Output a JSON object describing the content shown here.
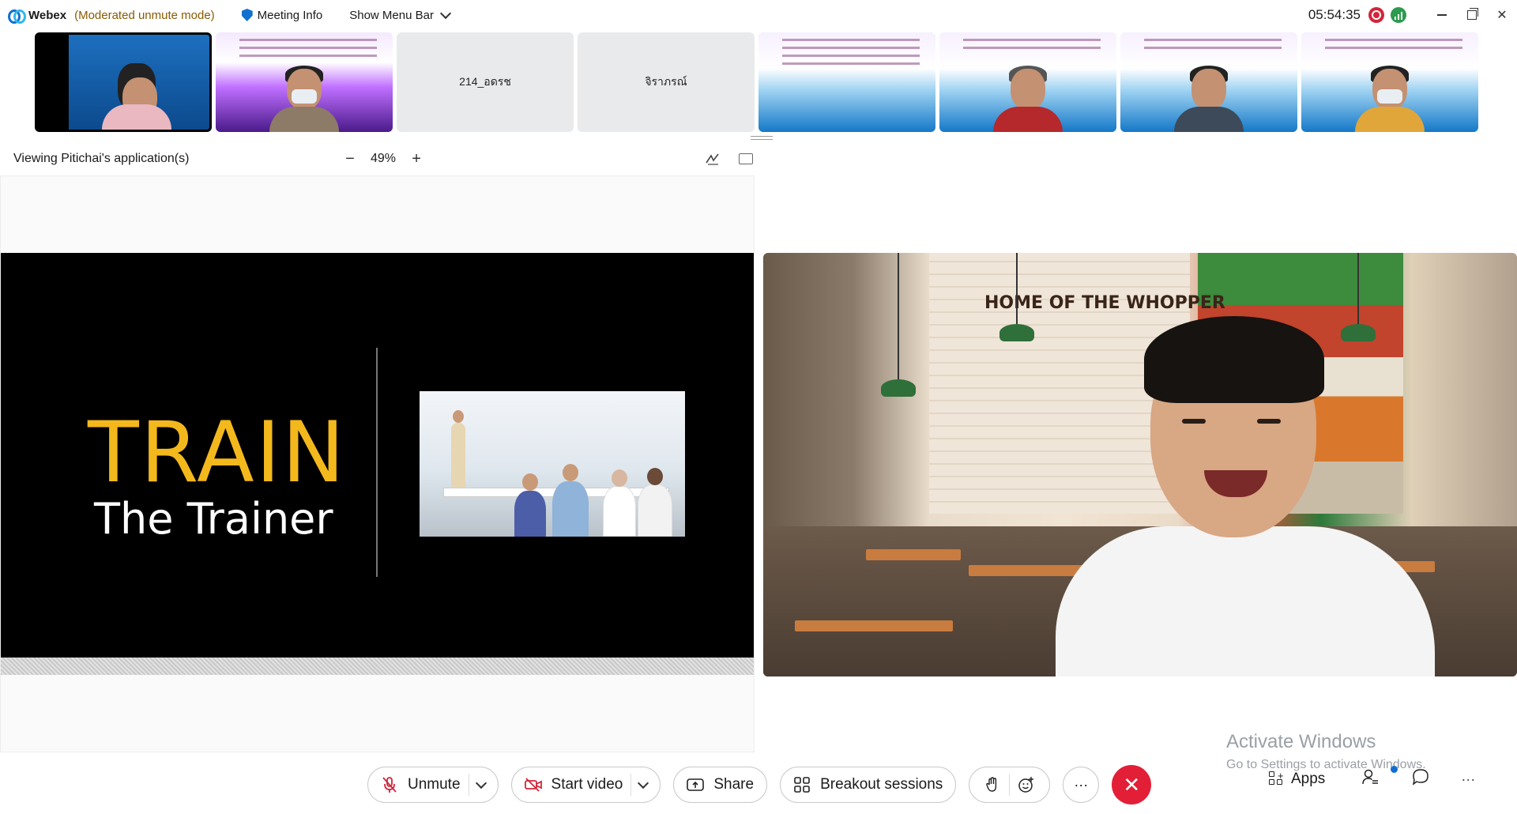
{
  "titlebar": {
    "app": "Webex",
    "mode": "(Moderated unmute mode)",
    "meeting_info": "Meeting Info",
    "show_menu_bar": "Show Menu Bar",
    "clock": "05:54:35"
  },
  "filmstrip": [
    {
      "name": "",
      "type": "video-dark"
    },
    {
      "name": "",
      "type": "video"
    },
    {
      "name": "214_อดรช",
      "type": "name"
    },
    {
      "name": "จิราภรณ์",
      "type": "name"
    },
    {
      "name": "",
      "type": "video"
    },
    {
      "name": "",
      "type": "video"
    },
    {
      "name": "",
      "type": "video"
    },
    {
      "name": "",
      "type": "video"
    }
  ],
  "viewbar": {
    "label": "Viewing Pitichai's application(s)",
    "zoom": "49%"
  },
  "slide": {
    "title": "TRAIN",
    "subtitle": "The Trainer"
  },
  "video": {
    "sign": "HOME OF THE WHOPPER"
  },
  "watermark": {
    "line1": "Activate Windows",
    "line2": "Go to Settings to activate Windows."
  },
  "controls": {
    "unmute": "Unmute",
    "start_video": "Start video",
    "share": "Share",
    "breakout": "Breakout sessions",
    "apps": "Apps"
  },
  "colors": {
    "accent": "#1170cf",
    "end_call": "#e21f37",
    "slide_title": "#f3b81c",
    "record": "#d3253a",
    "network": "#2c9b4e"
  }
}
